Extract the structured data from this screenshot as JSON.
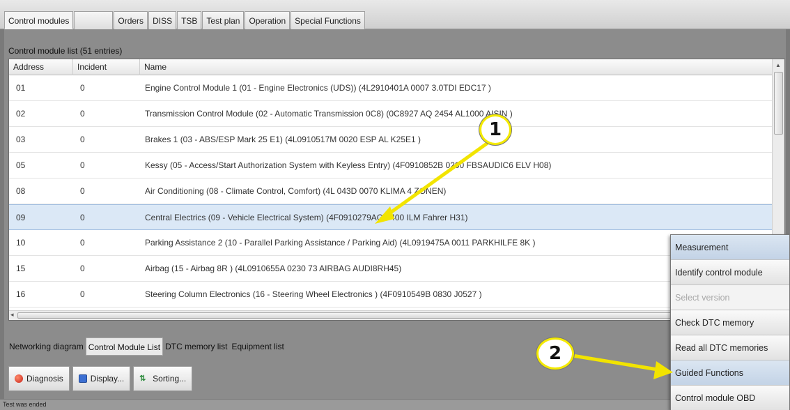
{
  "top_tabs": [
    {
      "label": "Control modules",
      "active": true
    },
    {
      "label": "",
      "active": false
    },
    {
      "label": "Orders",
      "active": false
    },
    {
      "label": "DISS",
      "active": false
    },
    {
      "label": "TSB",
      "active": false
    },
    {
      "label": "Test plan",
      "active": false
    },
    {
      "label": "Operation",
      "active": false
    },
    {
      "label": "Special Functions",
      "active": false
    }
  ],
  "list": {
    "title": "Control module list (51 entries)",
    "columns": {
      "address": "Address",
      "incident": "Incident",
      "name": "Name"
    },
    "rows": [
      {
        "address": "01",
        "incident": "0",
        "name": "Engine Control Module 1 (01 - Engine Electronics (UDS)) (4L2910401A   0007   3.0TDI EDC17 )"
      },
      {
        "address": "02",
        "incident": "0",
        "name": "Transmission Control Module (02 - Automatic Transmission 0C8) (0C8927  AQ   2454   AL1000 AISIN )"
      },
      {
        "address": "03",
        "incident": "0",
        "name": "Brakes 1 (03 - ABS/ESP Mark 25 E1) (4L0910517M    0020   ESP AL   K25E1 )"
      },
      {
        "address": "05",
        "incident": "0",
        "name": "Kessy (05 - Access/Start Authorization System with Keyless Entry) (4F0910852B    0200   FBSAUDIC6 ELV   H08)"
      },
      {
        "address": "08",
        "incident": "0",
        "name": "Air Conditioning (08 - Climate Control, Comfort) (4L  043D    0070   KLIMA 4 ZONEN)"
      },
      {
        "address": "09",
        "incident": "0",
        "name": "Central Electrics (09 - Vehicle Electrical System) (4F0910279AG    0400   ILM Fahrer       H31)"
      },
      {
        "address": "10",
        "incident": "0",
        "name": "Parking Assistance 2 (10 - Parallel Parking Assistance / Parking Aid) (4L0919475A    0011    PARKHILFE 8K )"
      },
      {
        "address": "15",
        "incident": "0",
        "name": "Airbag (15 - Airbag 8R ) (4L0910655A    0230   73 AIRBAG AUDI8RH45)"
      },
      {
        "address": "16",
        "incident": "0",
        "name": "Steering Column Electronics (16 - Steering Wheel Electronics ) (4F0910549B    0830   J0527            )"
      }
    ],
    "selected_address": "09"
  },
  "view_tabs": [
    {
      "label": "Networking diagram",
      "active": false
    },
    {
      "label": "Control Module List",
      "active": true
    },
    {
      "label": "DTC memory list",
      "active": false
    },
    {
      "label": "Equipment list",
      "active": false
    }
  ],
  "actions": [
    {
      "label": "Diagnosis",
      "icon": "diagnosis-icon"
    },
    {
      "label": "Display...",
      "icon": "display-icon"
    },
    {
      "label": "Sorting...",
      "icon": "sorting-icon"
    }
  ],
  "status": "Test was ended",
  "context_menu": [
    {
      "label": "Measurement",
      "state": "highlight"
    },
    {
      "label": "Identify control module",
      "state": "normal"
    },
    {
      "label": "Select version",
      "state": "disabled"
    },
    {
      "label": "Check DTC memory",
      "state": "normal"
    },
    {
      "label": "Read all DTC memories",
      "state": "normal"
    },
    {
      "label": "Guided Functions",
      "state": "highlight"
    },
    {
      "label": "Control module OBD",
      "state": "normal"
    }
  ],
  "callouts": {
    "one": "1",
    "two": "2"
  },
  "colors": {
    "arrow": "#f2e400",
    "callout_ring": "#f4ea00",
    "selected_row": "#dbe8f6"
  }
}
